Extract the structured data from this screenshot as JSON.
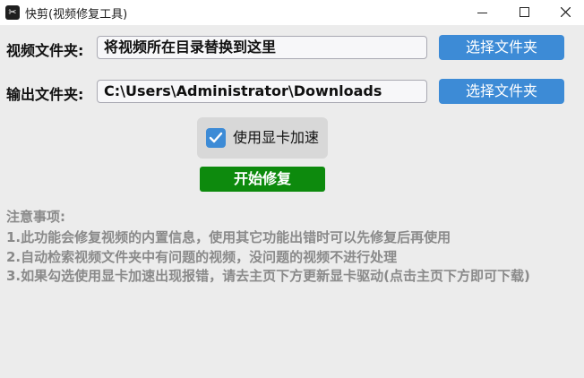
{
  "window": {
    "title": "快剪(视频修复工具)",
    "icon": "app-logo-icon"
  },
  "video_folder": {
    "label": "视频文件夹:",
    "value": "将视频所在目录替换到这里",
    "button": "选择文件夹"
  },
  "output_folder": {
    "label": "输出文件夹:",
    "value": "C:\\Users\\Administrator\\Downloads",
    "button": "选择文件夹"
  },
  "gpu": {
    "label": "使用显卡加速",
    "checked": true
  },
  "start_button": "开始修复",
  "notes": {
    "title": "注意事项:",
    "lines": [
      "1.此功能会修复视频的内置信息，使用其它功能出错时可以先修复后再使用",
      "2.自动检索视频文件夹中有问题的视频，没问题的视频不进行处理",
      "3.如果勾选使用显卡加速出现报错，请去主页下方更新显卡驱动(点击主页下方即可下载)"
    ]
  },
  "colors": {
    "accent": "#3d8bd6",
    "start": "#0d8a0d",
    "note_text": "#8a8a8a"
  }
}
